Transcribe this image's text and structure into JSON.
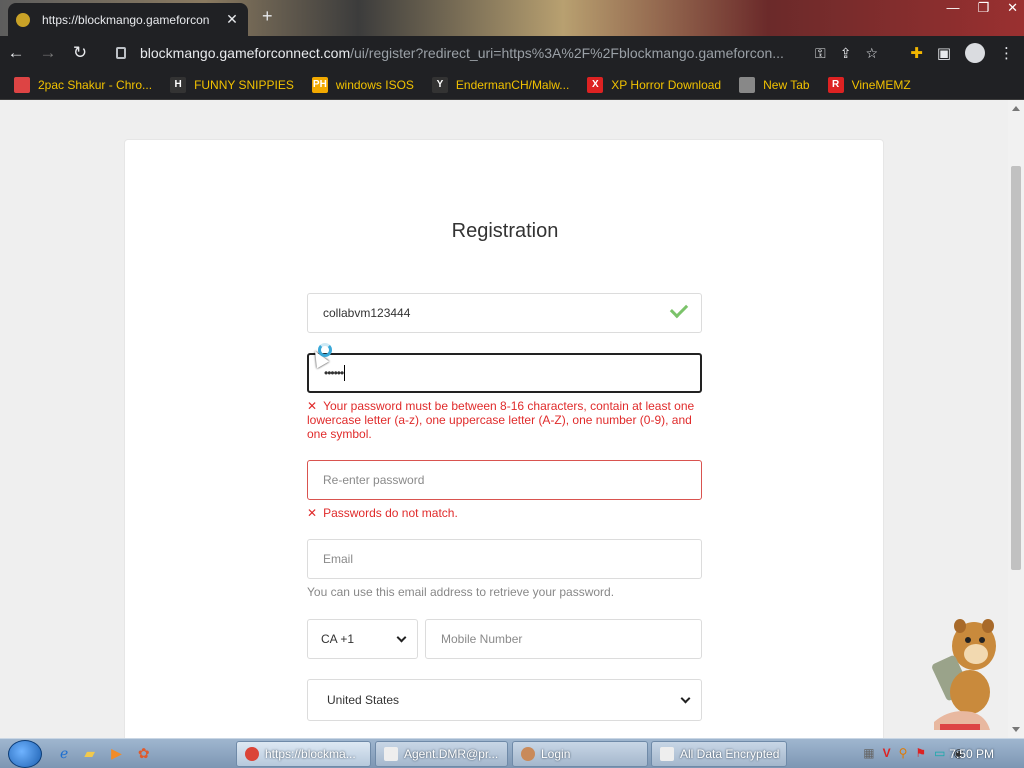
{
  "browser": {
    "tab_title": "https://blockmango.gameforcon",
    "url_host": "blockmango.gameforconnect.com",
    "url_path": "/ui/register?redirect_uri=https%3A%2F%2Fblockmango.gameforcon..."
  },
  "bookmarks": [
    {
      "label": "2pac Shakur - Chro...",
      "icon": "bookmark-icon-2pac",
      "color": "#d44"
    },
    {
      "label": "FUNNY SNIPPIES",
      "icon": "H",
      "color": "#333"
    },
    {
      "label": "windows ISOS",
      "icon": "PH",
      "color": "#f2a900"
    },
    {
      "label": "EndermanCH/Malw...",
      "icon": "Y",
      "color": "#333"
    },
    {
      "label": "XP Horror Download",
      "icon": "X",
      "color": "#d22"
    },
    {
      "label": "New Tab",
      "icon": "globe-icon",
      "color": "#888"
    },
    {
      "label": "VineMEMZ",
      "icon": "R",
      "color": "#d22"
    }
  ],
  "form": {
    "title": "Registration",
    "username_value": "collabvm123444",
    "password_masked": "••••••",
    "password_error": "Your password must be between 8-16 characters, contain at least one lowercase letter (a-z), one uppercase letter (A-Z), one number (0-9), and one symbol.",
    "reenter_placeholder": "Re-enter password",
    "reenter_error": "Passwords do not match.",
    "email_placeholder": "Email",
    "email_hint": "You can use this email address to retrieve your password.",
    "country_code": "CA +1",
    "mobile_placeholder": "Mobile Number",
    "country": "United States"
  },
  "taskbar": {
    "tasks": [
      "https://blockma...",
      "Agent.DMR@pr...",
      "Login",
      "All Data Encrypted"
    ],
    "clock": "7:50 PM"
  }
}
